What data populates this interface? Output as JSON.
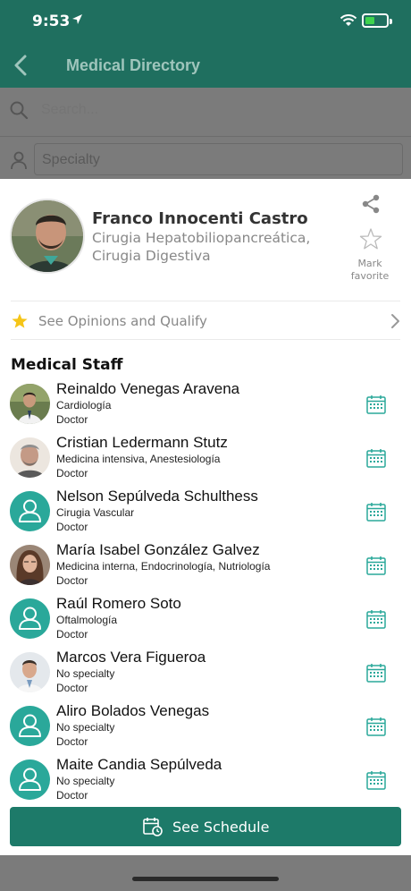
{
  "status_bar": {
    "time": "9:53"
  },
  "header": {
    "title": "Medical Directory"
  },
  "search": {
    "placeholder": "Search..."
  },
  "specialty_filter": {
    "placeholder": "Specialty"
  },
  "doctor": {
    "name": "Franco Innocenti Castro",
    "specialties": "Cirugia Hepatobiliopancreática, Cirugia Digestiva",
    "favorite_label": "Mark favorite"
  },
  "opinions": {
    "label": "See Opinions and Qualify"
  },
  "staff": {
    "title": "Medical Staff",
    "members": [
      {
        "name": "Reinaldo Venegas Aravena",
        "specialty": "Cardiología",
        "role": "Doctor",
        "avatar": "photo"
      },
      {
        "name": "Cristian Ledermann Stutz",
        "specialty": "Medicina intensiva, Anestesiología",
        "role": "Doctor",
        "avatar": "photo"
      },
      {
        "name": "Nelson Sepúlveda Schulthess",
        "specialty": "Cirugia Vascular",
        "role": "Doctor",
        "avatar": "generic-person-icon"
      },
      {
        "name": "María Isabel González Galvez",
        "specialty": "Medicina interna, Endocrinología, Nutriología",
        "role": "Doctor",
        "avatar": "photo"
      },
      {
        "name": "Raúl Romero Soto",
        "specialty": "Oftalmología",
        "role": "Doctor",
        "avatar": "generic-person-icon"
      },
      {
        "name": "Marcos Vera Figueroa",
        "specialty": "No specialty",
        "role": "Doctor",
        "avatar": "photo"
      },
      {
        "name": "Aliro Bolados Venegas",
        "specialty": "No specialty",
        "role": "Doctor",
        "avatar": "generic-person-icon"
      },
      {
        "name": "Maite Candia Sepúlveda",
        "specialty": "No specialty",
        "role": "Doctor",
        "avatar": "generic-person-icon"
      }
    ]
  },
  "schedule_button": {
    "label": "See Schedule"
  },
  "colors": {
    "header_teal": "#1f6f5f",
    "accent_teal": "#2aa89a",
    "button_teal": "#1d7a69",
    "star_yellow": "#f5c518",
    "overlay_gray": "#7b7b7b"
  }
}
